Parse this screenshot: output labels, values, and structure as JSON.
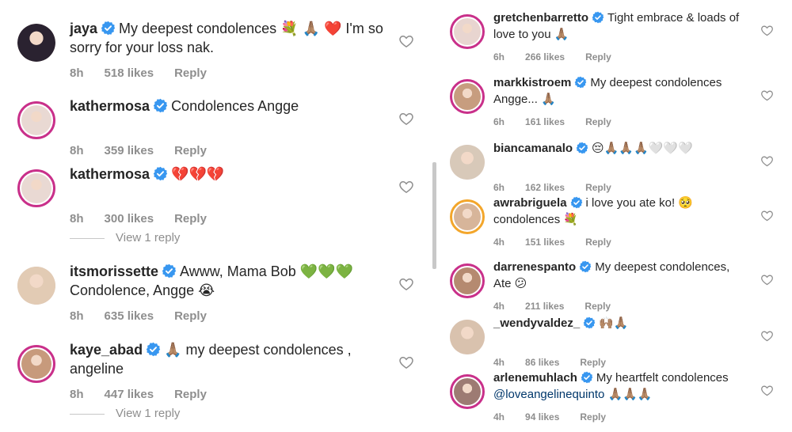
{
  "left": {
    "comments": [
      {
        "username": "jaya",
        "text": "My deepest condolences 💐 🙏🏽 ❤️ I'm so sorry for your loss nak.",
        "time": "8h",
        "likes": "518 likes",
        "reply": "Reply"
      },
      {
        "username": "kathermosa",
        "text": "Condolences Angge",
        "time": "8h",
        "likes": "359 likes",
        "reply": "Reply"
      },
      {
        "username": "kathermosa",
        "text": "💔💔💔",
        "time": "8h",
        "likes": "300 likes",
        "reply": "Reply",
        "view_replies": "View 1 reply"
      },
      {
        "username": "itsmorissette",
        "text": "Awww, Mama Bob 💚💚💚 Condolence, Angge 😭",
        "time": "8h",
        "likes": "635 likes",
        "reply": "Reply"
      },
      {
        "username": "kaye_abad",
        "text": "🙏🏽 my deepest condolences , angeline",
        "time": "8h",
        "likes": "447 likes",
        "reply": "Reply",
        "view_replies": "View 1 reply"
      }
    ]
  },
  "right": {
    "comments": [
      {
        "username": "gretchenbarretto",
        "text": "Tight embrace & loads of love to you 🙏🏽",
        "time": "6h",
        "likes": "266 likes",
        "reply": "Reply"
      },
      {
        "username": "markkistroem",
        "text": "My deepest condolences Angge... 🙏🏽",
        "time": "6h",
        "likes": "161 likes",
        "reply": "Reply"
      },
      {
        "username": "biancamanalo",
        "text": "😔🙏🏽🙏🏽🙏🏽🤍🤍🤍",
        "time": "6h",
        "likes": "162 likes",
        "reply": "Reply"
      },
      {
        "username": "awrabriguela",
        "text": "i love you ate ko! 🥺 condolences 💐",
        "time": "4h",
        "likes": "151 likes",
        "reply": "Reply"
      },
      {
        "username": "darrenespanto",
        "text": "My deepest condolences, Ate 😕",
        "time": "4h",
        "likes": "211 likes",
        "reply": "Reply"
      },
      {
        "username": "_wendyvaldez_",
        "text": "🙌🏽🙏🏽",
        "time": "4h",
        "likes": "86 likes",
        "reply": "Reply"
      },
      {
        "username": "arlenemuhlach",
        "text": "My heartfelt condolences",
        "mention": "@loveangelinequinto",
        "text_after": "🙏🏽🙏🏽🙏🏽",
        "time": "4h",
        "likes": "94 likes",
        "reply": "Reply"
      }
    ]
  },
  "colors": {
    "verified": "#3897f0",
    "muted": "#8e8e8e",
    "text": "#262626",
    "story_ring": "#f3a62b",
    "mention": "#00376b"
  }
}
